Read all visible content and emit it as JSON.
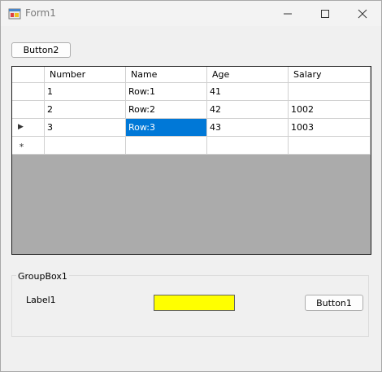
{
  "window": {
    "title": "Form1"
  },
  "top_button": {
    "label": "Button2"
  },
  "grid": {
    "columns": [
      "Number",
      "Name",
      "Age",
      "Salary"
    ],
    "rows": [
      {
        "number": "1",
        "name": "Row:1",
        "age": "41",
        "salary": ""
      },
      {
        "number": "2",
        "name": "Row:2",
        "age": "42",
        "salary": "1002"
      },
      {
        "number": "3",
        "name": "Row:3",
        "age": "43",
        "salary": "1003"
      }
    ],
    "new_row_marker": "*",
    "current_row_marker": "▶",
    "selected_cell_color": "#0078d7",
    "empty_area_color": "#ababab"
  },
  "groupbox": {
    "title": "GroupBox1",
    "label": "Label1",
    "button_label": "Button1",
    "swatch_color": "#ffff00"
  }
}
